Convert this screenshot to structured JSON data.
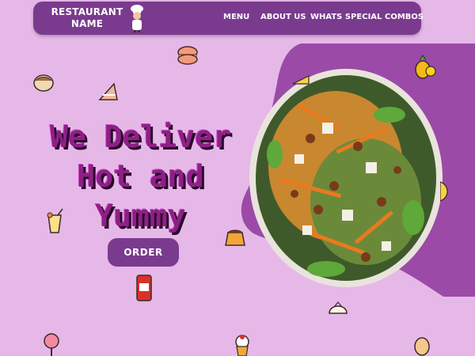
{
  "navbar": {
    "brand": [
      "RESTAURANT",
      "NAME"
    ],
    "logo_icon": "chef-icon",
    "items": [
      {
        "label": "MENU"
      },
      {
        "label": "ABOUT US"
      },
      {
        "label": "WHATS SPECIAL"
      },
      {
        "label": "COMBOS"
      }
    ]
  },
  "hero": {
    "lines": [
      "We Deliver",
      "Hot and",
      "Yummy"
    ],
    "button": "ORDER"
  },
  "colors": {
    "background": "#e6b8e8",
    "primary": "#7a3a8e",
    "blob": "#9b4aa8",
    "headline": "#8e1f86"
  },
  "decor_icons": [
    "salad-bowl-image",
    "macaron-icon",
    "cookie-icon",
    "cake-slice-icon",
    "pineapple-icon",
    "juice-glass-icon",
    "pudding-icon",
    "soda-can-icon",
    "dumpling-icon",
    "lollipop-icon",
    "cupcake-icon",
    "peanut-icon"
  ]
}
